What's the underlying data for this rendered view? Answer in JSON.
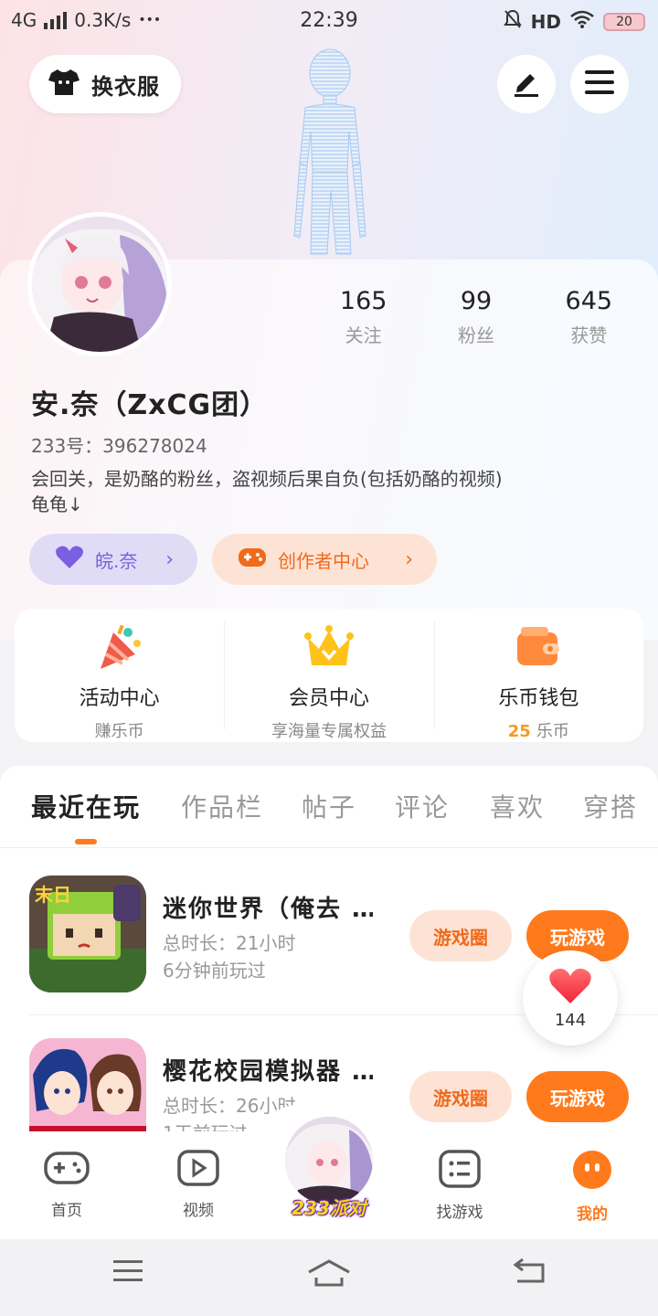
{
  "status_bar": {
    "network": "4G",
    "speed": "0.3K/s",
    "dots": "•••",
    "time": "22:39",
    "hd": "HD",
    "battery": "20"
  },
  "header": {
    "outfit_label": "换衣服"
  },
  "profile": {
    "stats": [
      {
        "num": "165",
        "label": "关注"
      },
      {
        "num": "99",
        "label": "粉丝"
      },
      {
        "num": "645",
        "label": "获赞"
      }
    ],
    "nickname": "安.奈（ZxCG团）",
    "uid": "233号：396278024",
    "bio_line1": "会回关，是奶酪的粉丝，盗视频后果自负(包括奶酪的视频)",
    "bio_line2": "龟龟↓",
    "tag_purple": "皖.奈",
    "tag_orange": "创作者中心"
  },
  "quick": [
    {
      "title": "活动中心",
      "sub": "赚乐币"
    },
    {
      "title": "会员中心",
      "sub": "享海量专属权益"
    },
    {
      "title": "乐币钱包",
      "sub_value": "25",
      "sub": "乐币"
    }
  ],
  "tabs": [
    "最近在玩",
    "作品栏",
    "帖子",
    "评论",
    "喜欢",
    "穿搭"
  ],
  "games": [
    {
      "title": "迷你世界（俺去 …",
      "duration": "总时长：21小时",
      "last_played": "6分钟前玩过",
      "circle_btn": "游戏圈",
      "play_btn": "玩游戏"
    },
    {
      "title": "樱花校园模拟器 …",
      "duration": "总时长：26小时",
      "last_played": "1天前玩过",
      "circle_btn": "游戏圈",
      "play_btn": "玩游戏"
    }
  ],
  "like_count": "144",
  "bottom_nav": {
    "home": "首页",
    "video": "视频",
    "center": "233派对",
    "find": "找游戏",
    "mine": "我的"
  },
  "colors": {
    "accent": "#ff7a1c",
    "accent_soft": "#fde3d6",
    "purple": "#7a5fe0",
    "gold": "#f59a23"
  }
}
